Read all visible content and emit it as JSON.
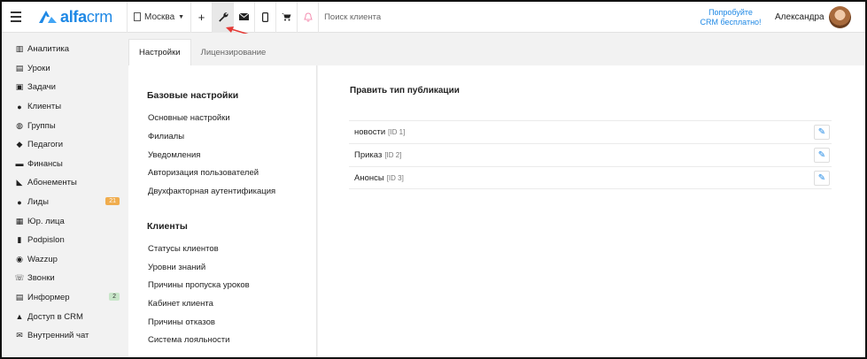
{
  "brand": {
    "name_alfa": "alfa",
    "name_crm": "crm"
  },
  "topbar": {
    "branch": "Москва",
    "search_placeholder": "Поиск клиента",
    "promo_line1": "Попробуйте",
    "promo_line2": "CRM бесплатно!",
    "user": "Александра",
    "icons": [
      "plus-icon",
      "wrench-icon",
      "mail-icon",
      "mobile-icon",
      "cart-icon",
      "bell-icon"
    ]
  },
  "sidebar": {
    "items": [
      {
        "label": "Аналитика",
        "icon": "▥"
      },
      {
        "label": "Уроки",
        "icon": "▤"
      },
      {
        "label": "Задачи",
        "icon": "▣"
      },
      {
        "label": "Клиенты",
        "icon": "●"
      },
      {
        "label": "Группы",
        "icon": "◍"
      },
      {
        "label": "Педагоги",
        "icon": "◆"
      },
      {
        "label": "Финансы",
        "icon": "▬"
      },
      {
        "label": "Абонементы",
        "icon": "◣"
      },
      {
        "label": "Лиды",
        "icon": "●",
        "badge": "21"
      },
      {
        "label": "Юр. лица",
        "icon": "▦"
      },
      {
        "label": "Podpislon",
        "icon": "▮"
      },
      {
        "label": "Wazzup",
        "icon": "◉"
      },
      {
        "label": "Звонки",
        "icon": "☏"
      },
      {
        "label": "Информер",
        "icon": "▤",
        "badge": "2"
      },
      {
        "label": "Доступ в CRM",
        "icon": "▲"
      },
      {
        "label": "Внутренний чат",
        "icon": "✉"
      }
    ]
  },
  "tabs": {
    "settings": "Настройки",
    "licensing": "Лицензирование"
  },
  "left": {
    "basic_title": "Базовые настройки",
    "basic_links": [
      "Основные настройки",
      "Филиалы",
      "Уведомления",
      "Авторизация пользователей",
      "Двухфакторная аутентификация"
    ],
    "clients_title": "Клиенты",
    "clients_links": [
      "Статусы клиентов",
      "Уровни знаний",
      "Причины пропуска уроков",
      "Кабинет клиента",
      "Причины отказов",
      "Система лояльности"
    ]
  },
  "right": {
    "title": "Править тип публикации",
    "rows": [
      {
        "name": "новости",
        "id": "[ID 1]"
      },
      {
        "name": "Приказ",
        "id": "[ID 2]"
      },
      {
        "name": "Анонсы",
        "id": "[ID 3]"
      }
    ]
  },
  "colors": {
    "accent": "#1e88e5",
    "badge_orange": "#f0ad4e",
    "badge_green": "#c8e6c9",
    "arrow": "#e53935"
  }
}
